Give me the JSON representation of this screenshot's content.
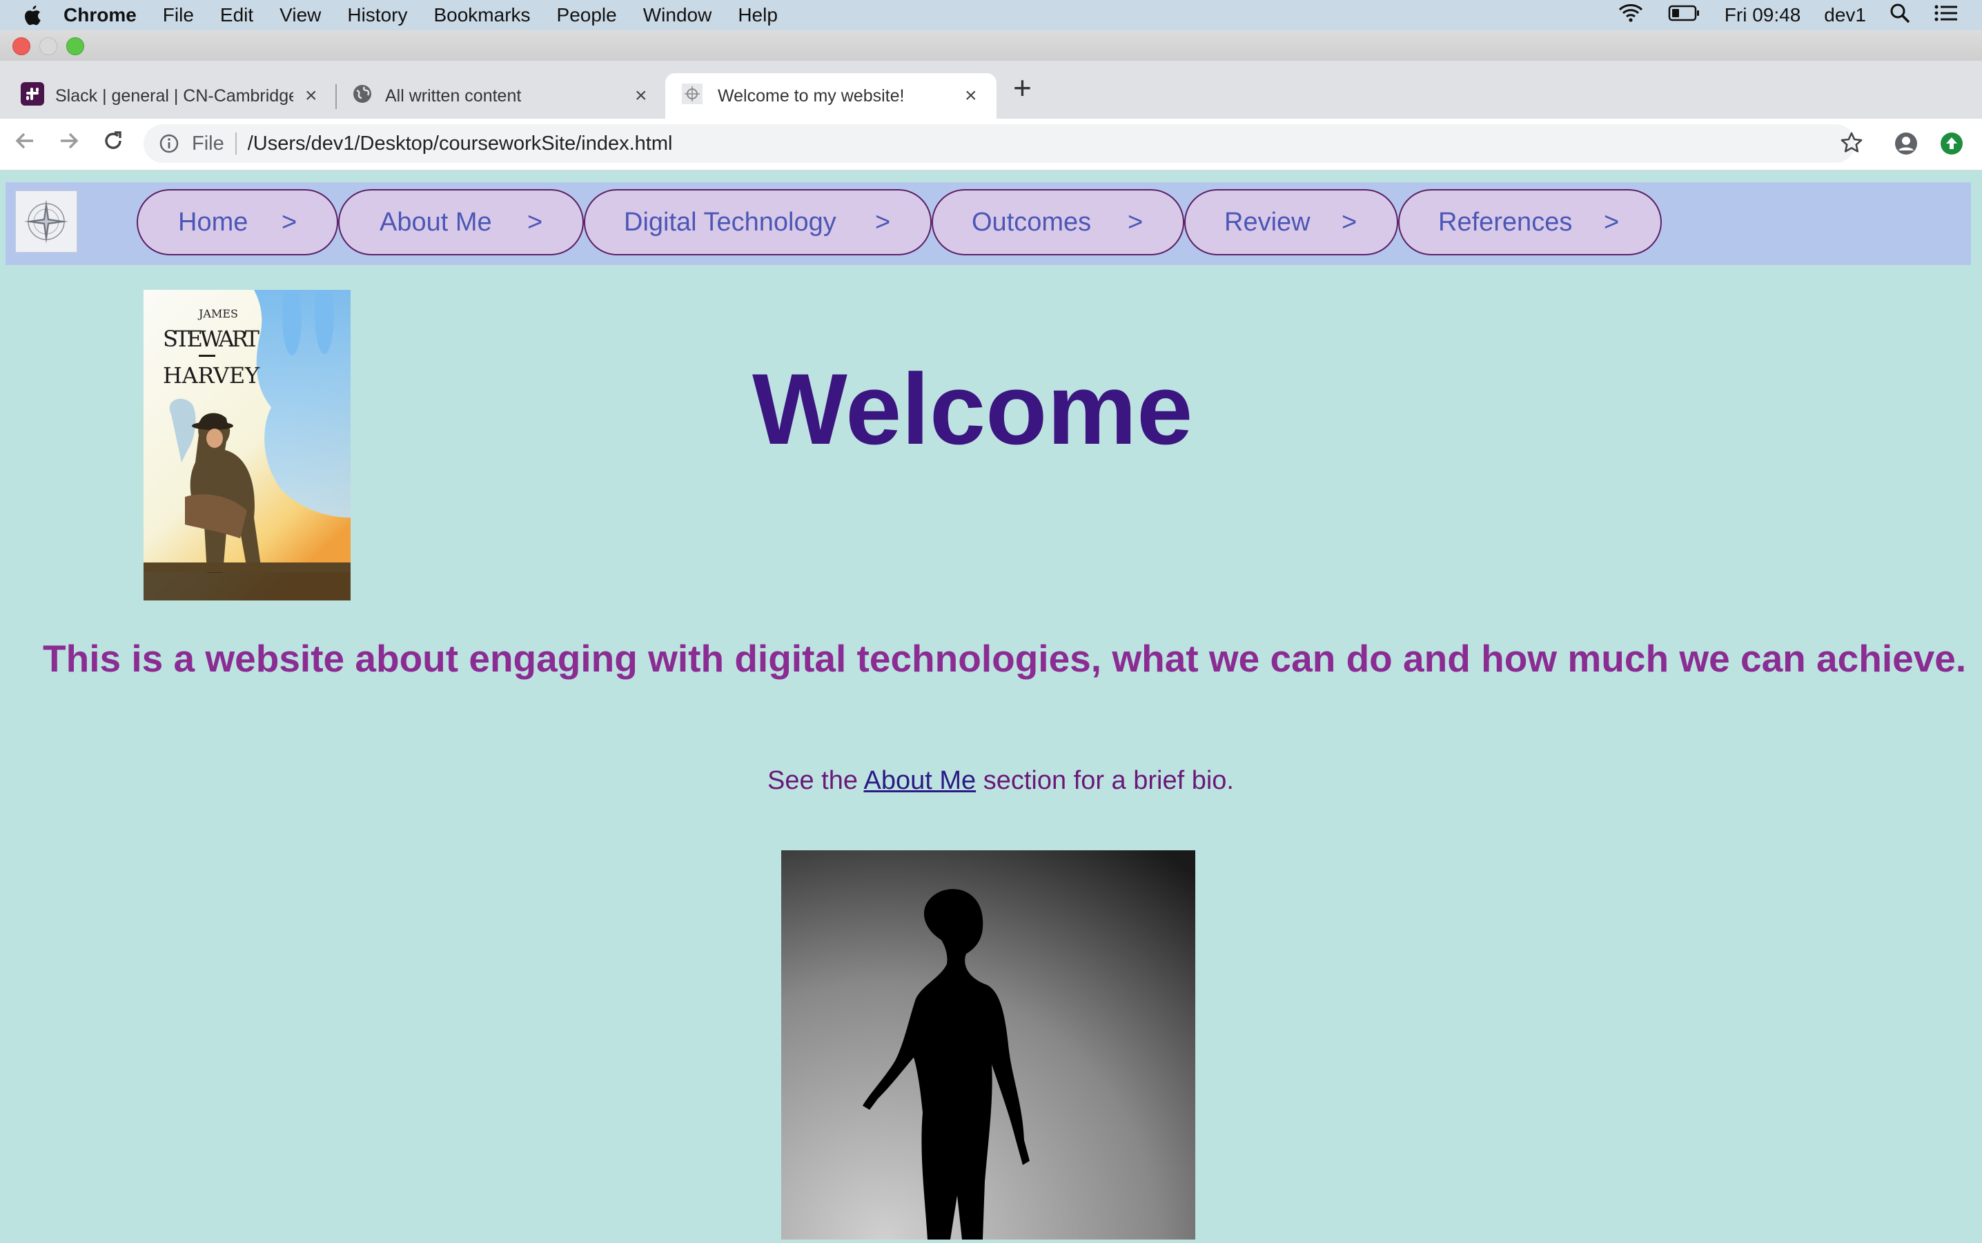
{
  "menubar": {
    "app": "Chrome",
    "items": [
      "File",
      "Edit",
      "View",
      "History",
      "Bookmarks",
      "People",
      "Window",
      "Help"
    ],
    "clock": "Fri 09:48",
    "user": "dev1"
  },
  "tabs": [
    {
      "title": "Slack | general | CN-Cambridge",
      "active": false
    },
    {
      "title": "All written content",
      "active": false
    },
    {
      "title": "Welcome to my website!",
      "active": true
    }
  ],
  "address": {
    "scheme": "File",
    "url": "/Users/dev1/Desktop/courseworkSite/index.html"
  },
  "site": {
    "nav": [
      {
        "label": "Home",
        "arrow": ">"
      },
      {
        "label": "About Me",
        "arrow": ">"
      },
      {
        "label": "Digital Technology",
        "arrow": ">"
      },
      {
        "label": "Outcomes",
        "arrow": ">"
      },
      {
        "label": "Review",
        "arrow": ">"
      },
      {
        "label": "References",
        "arrow": ">"
      }
    ],
    "poster": {
      "line1": "JAMES",
      "line2": "STEWART",
      "line3": "HARVEY"
    },
    "heading": "Welcome",
    "tagline": "This is a website about engaging with digital technologies, what we can do and how much we can achieve.",
    "bio": {
      "before": "See the",
      "link": "About Me",
      "after": "section for a brief bio."
    }
  },
  "colors": {
    "page_bg": "#bde3e1",
    "nav_bg": "#b5c6ec",
    "pill_bg": "#d9c9e9",
    "pill_text": "#4b57b5",
    "heading": "#3b1580",
    "tagline": "#8b2c93"
  }
}
